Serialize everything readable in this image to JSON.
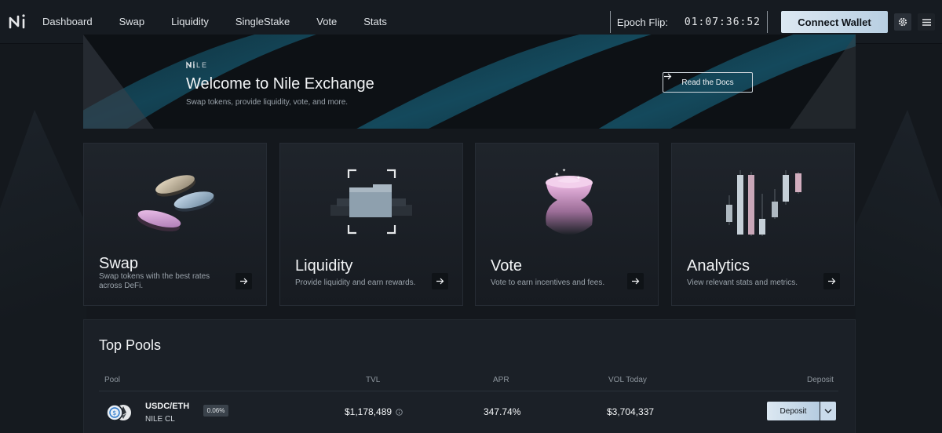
{
  "nav": {
    "links": [
      "Dashboard",
      "Swap",
      "Liquidity",
      "SingleStake",
      "Vote",
      "Stats"
    ],
    "epoch_label": "Epoch Flip:",
    "epoch_time": "01:07:36:52",
    "connect_label": "Connect Wallet"
  },
  "hero": {
    "brand": "NILE",
    "title": "Welcome to Nile Exchange",
    "subtitle": "Swap tokens, provide liquidity, vote, and more.",
    "docs_label": "Read the Docs"
  },
  "cards": [
    {
      "title": "Swap",
      "desc": "Swap tokens with the best rates across DeFi."
    },
    {
      "title": "Liquidity",
      "desc": "Provide liquidity and earn rewards."
    },
    {
      "title": "Vote",
      "desc": "Vote to earn incentives and fees."
    },
    {
      "title": "Analytics",
      "desc": "View relevant stats and metrics."
    }
  ],
  "pools": {
    "title": "Top Pools",
    "headers": {
      "pool": "Pool",
      "tvl": "TVL",
      "apr": "APR",
      "vol": "VOL Today",
      "deposit": "Deposit"
    },
    "rows": [
      {
        "name": "USDC/ETH",
        "type": "NILE CL",
        "fee": "0.06%",
        "tvl": "$1,178,489",
        "apr": "347.74%",
        "vol": "$3,704,337",
        "deposit_label": "Deposit"
      }
    ]
  },
  "colors": {
    "background": "#14181d",
    "accent": "#c9dcec",
    "hero_stripe": "#123a4a"
  }
}
